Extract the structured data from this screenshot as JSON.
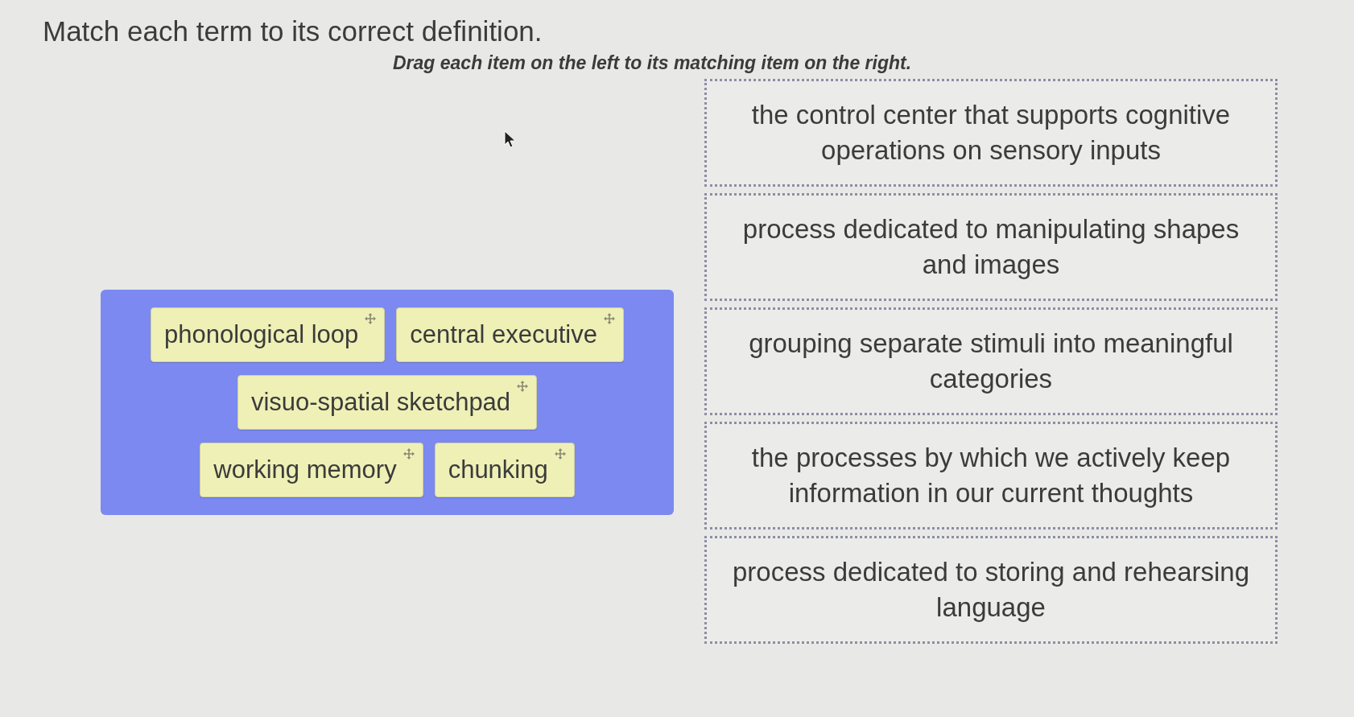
{
  "title": "Match each term to its correct definition.",
  "instruction": "Drag each item on the left to its matching item on the right.",
  "terms": [
    {
      "label": "phonological loop"
    },
    {
      "label": "central executive"
    },
    {
      "label": "visuo-spatial sketchpad"
    },
    {
      "label": "working memory"
    },
    {
      "label": "chunking"
    }
  ],
  "definitions": [
    {
      "text": "the control center that supports cognitive operations on sensory inputs"
    },
    {
      "text": "process dedicated to manipulating shapes and images"
    },
    {
      "text": "grouping separate stimuli into meaningful categories"
    },
    {
      "text": "the processes by which we actively keep information in our current thoughts"
    },
    {
      "text": "process dedicated to storing and rehearsing language"
    }
  ]
}
